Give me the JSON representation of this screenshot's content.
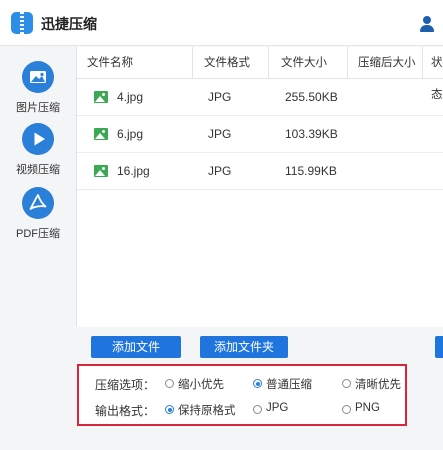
{
  "app": {
    "title": "迅捷压缩"
  },
  "sidebar": {
    "items": [
      {
        "label": "图片压缩",
        "icon": "image-icon"
      },
      {
        "label": "视频压缩",
        "icon": "play-icon"
      },
      {
        "label": "PDF压缩",
        "icon": "pdf-icon"
      }
    ]
  },
  "table": {
    "headers": [
      "文件名称",
      "文件格式",
      "文件大小",
      "压缩后大小",
      "状态"
    ],
    "rows": [
      {
        "name": "4.jpg",
        "format": "JPG",
        "size": "255.50KB"
      },
      {
        "name": "6.jpg",
        "format": "JPG",
        "size": "103.39KB"
      },
      {
        "name": "16.jpg",
        "format": "JPG",
        "size": "115.99KB"
      }
    ]
  },
  "buttons": {
    "add_file": "添加文件",
    "add_folder": "添加文件夹"
  },
  "options": {
    "compress_label": "压缩选项：",
    "compress_choices": [
      "缩小优先",
      "普通压缩",
      "清晰优先"
    ],
    "compress_selected": "普通压缩",
    "format_label": "输出格式：",
    "format_choices": [
      "保持原格式",
      "JPG",
      "PNG"
    ],
    "format_selected": "保持原格式"
  },
  "colors": {
    "accent": "#1f74de",
    "highlight_border": "#d7263d",
    "image_icon": "#3aa855"
  }
}
